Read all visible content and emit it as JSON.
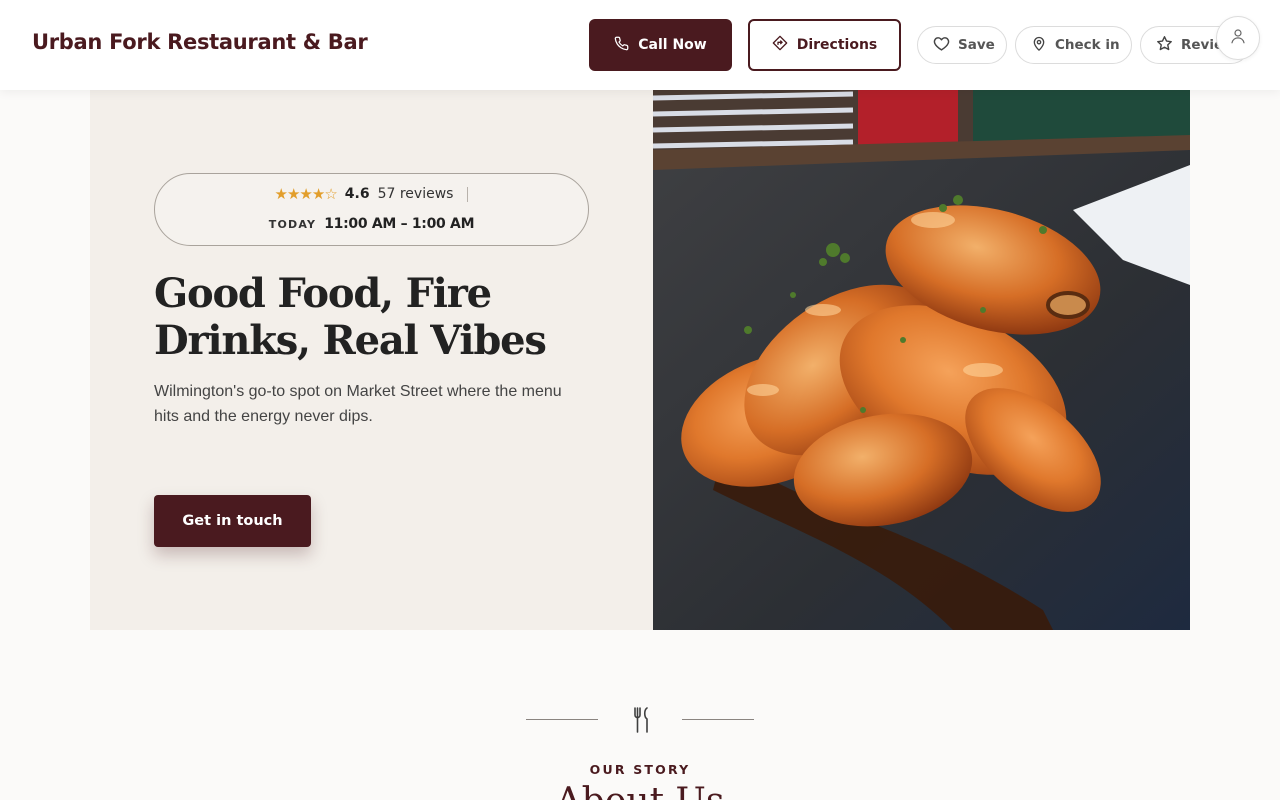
{
  "header": {
    "brand": "Urban Fork Restaurant & Bar",
    "call_label": "Call Now",
    "directions_label": "Directions",
    "save_label": "Save",
    "checkin_label": "Check in",
    "review_label": "Revie",
    "icons": {
      "call": "phone-icon",
      "directions": "directions-icon",
      "save": "heart-icon",
      "checkin": "map-pin-icon",
      "review": "star-icon",
      "account": "user-icon"
    }
  },
  "hero": {
    "stars": "★★★★☆",
    "rating": "4.6",
    "reviews": "57 reviews",
    "today_label": "TODAY",
    "hours": "11:00 AM – 1:00 AM",
    "title": "Good Food, Fire Drinks, Real Vibes",
    "subtitle": "Wilmington's go-to spot on Market Street where the menu hits and the energy never dips.",
    "cta_label": "Get in touch",
    "image_subject": "glazed chicken wings with parsley on a slate board"
  },
  "story": {
    "icon": "fork-knife-icon",
    "eyebrow": "OUR STORY",
    "title": "About Us"
  },
  "colors": {
    "brand": "#4a1a1f",
    "hero_bg": "#f3efea",
    "star": "#e29e2b"
  }
}
